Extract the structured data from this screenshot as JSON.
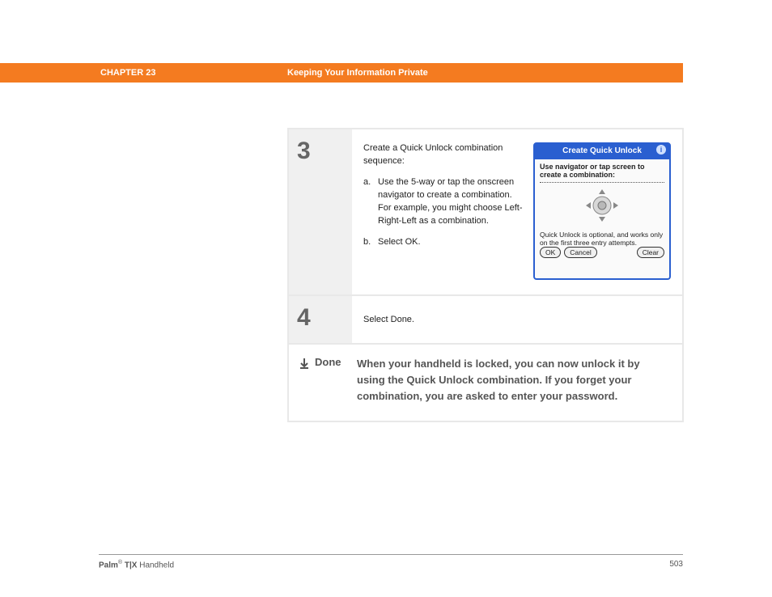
{
  "header": {
    "chapter": "CHAPTER 23",
    "title": "Keeping Your Information Private"
  },
  "steps": {
    "step3": {
      "num": "3",
      "intro": "Create a Quick Unlock combination sequence:",
      "a_marker": "a.",
      "a_text": "Use the 5-way or tap the onscreen navigator to create a combination.\nFor example, you might choose Left-Right-Left as a combination.",
      "b_marker": "b.",
      "b_text": "Select OK."
    },
    "step4": {
      "num": "4",
      "text": "Select Done."
    }
  },
  "device": {
    "title": "Create Quick Unlock",
    "instruction": "Use navigator or tap screen to create a combination:",
    "note": "Quick Unlock is optional, and works only on the first three entry attempts.",
    "buttons": {
      "ok": "OK",
      "cancel": "Cancel",
      "clear": "Clear"
    }
  },
  "done": {
    "label": "Done",
    "text": "When your handheld is locked, you can now unlock it by using the Quick Unlock combination. If you forget your combination, you are asked to enter your password."
  },
  "footer": {
    "brand": "Palm",
    "reg": "®",
    "model": " T|X",
    "suffix": " Handheld",
    "page": "503"
  }
}
